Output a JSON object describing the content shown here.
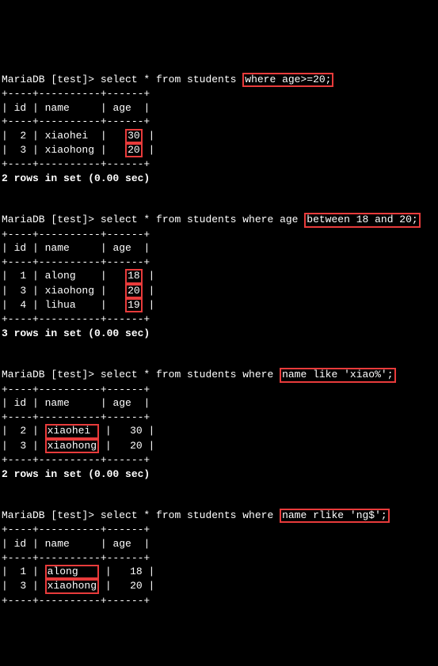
{
  "prompt": "MariaDB [test]> ",
  "headers": {
    "id": "id",
    "name": "name",
    "age": "age"
  },
  "q1": {
    "sql_prefix": "select * from students ",
    "sql_hl": "where age>=20;",
    "rows": [
      {
        "id": "2",
        "name": "xiaohei ",
        "age": "30"
      },
      {
        "id": "3",
        "name": "xiaohong",
        "age": "20"
      }
    ],
    "summary": "2 rows in set (0.00 sec)"
  },
  "q2": {
    "sql_prefix": "select * from students where age ",
    "sql_hl": "between 18 and 20;",
    "rows": [
      {
        "id": "1",
        "name": "along   ",
        "age": "18"
      },
      {
        "id": "3",
        "name": "xiaohong",
        "age": "20"
      },
      {
        "id": "4",
        "name": "lihua   ",
        "age": "19"
      }
    ],
    "summary": "3 rows in set (0.00 sec)"
  },
  "q3": {
    "sql_prefix": "select * from students where ",
    "sql_hl": "name like 'xiao%';",
    "rows": [
      {
        "id": "2",
        "name": "xiaohei ",
        "age": "30"
      },
      {
        "id": "3",
        "name": "xiaohong",
        "age": "20"
      }
    ],
    "summary": "2 rows in set (0.00 sec)"
  },
  "q4": {
    "sql_prefix": "select * from students where ",
    "sql_hl": "name rlike 'ng$';",
    "rows": [
      {
        "id": "1",
        "name": "along   ",
        "age": "18"
      },
      {
        "id": "3",
        "name": "xiaohong",
        "age": "20"
      }
    ]
  },
  "border": {
    "sep": "+----+----------+------+",
    "head": "| id | name     | age  |"
  }
}
